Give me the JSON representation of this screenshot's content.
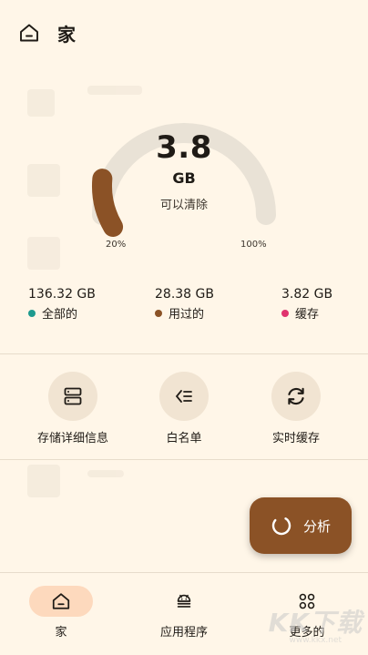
{
  "header": {
    "title": "家",
    "icon": "home-icon"
  },
  "gauge": {
    "value": "3.8",
    "unit": "GB",
    "caption": "可以清除",
    "min_label": "20%",
    "max_label": "100%",
    "fill_fraction": 0.2,
    "track_color": "#E9E2D6",
    "fill_color": "#8B5226"
  },
  "stats": [
    {
      "value": "136.32 GB",
      "label": "全部的",
      "color": "#1E9A8E"
    },
    {
      "value": "28.38 GB",
      "label": "用过的",
      "color": "#8B5226"
    },
    {
      "value": "3.82 GB",
      "label": "缓存",
      "color": "#E0336E"
    }
  ],
  "actions": [
    {
      "label": "存储详细信息",
      "icon": "storage-icon"
    },
    {
      "label": "白名单",
      "icon": "list-check-icon"
    },
    {
      "label": "实时缓存",
      "icon": "refresh-icon"
    }
  ],
  "fab": {
    "label": "分析",
    "icon": "spinner-icon"
  },
  "bottom_nav": [
    {
      "label": "家",
      "icon": "home-icon",
      "active": true
    },
    {
      "label": "应用程序",
      "icon": "android-icon",
      "active": false
    },
    {
      "label": "更多的",
      "icon": "grid-icon",
      "active": false
    }
  ],
  "watermark": {
    "text": "KK下载",
    "url": "www.kkx.net"
  }
}
